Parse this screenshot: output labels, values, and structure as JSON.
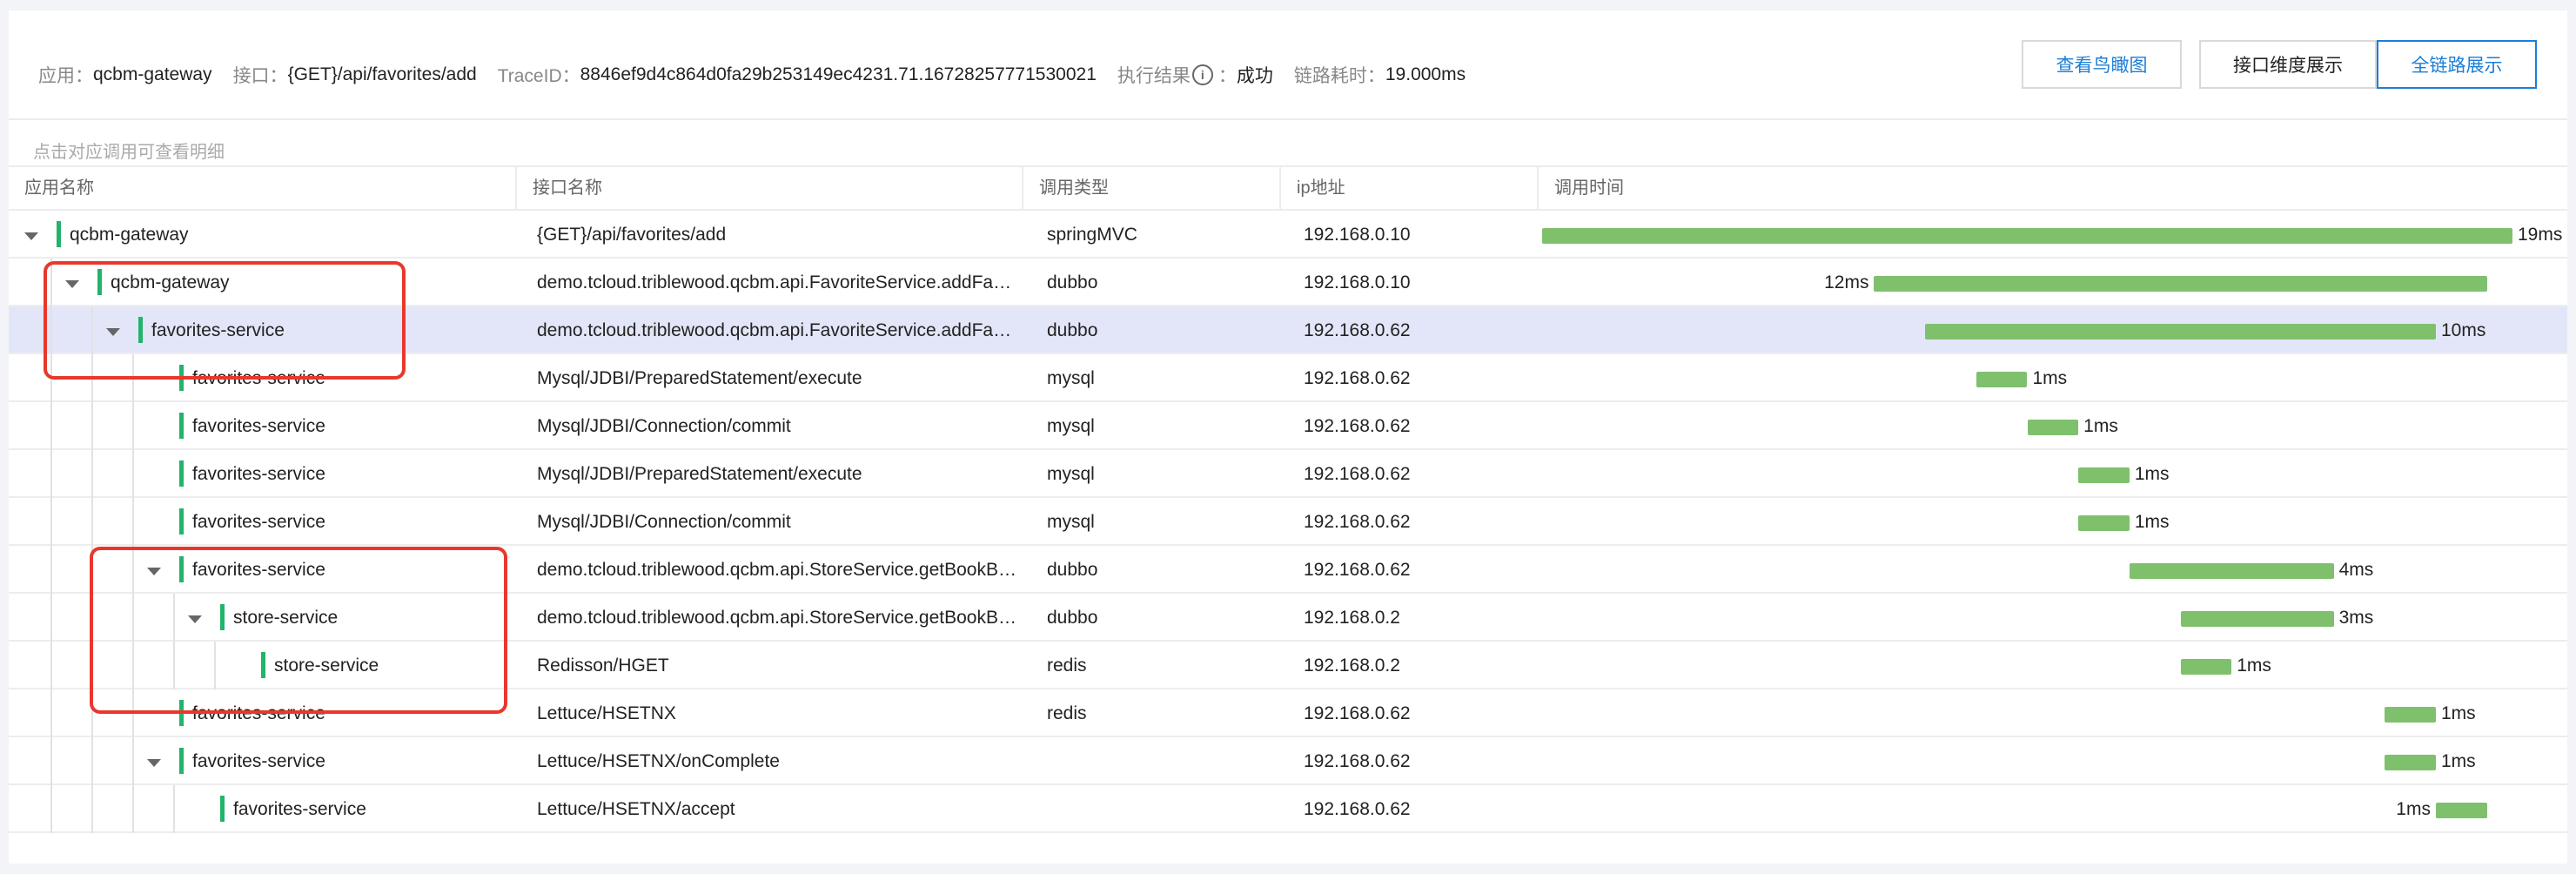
{
  "header": {
    "app_label": "应用：",
    "app_value": "qcbm-gateway",
    "iface_label": "接口：",
    "iface_value": "{GET}/api/favorites/add",
    "trace_label": "TraceID：",
    "trace_value": "8846ef9d4c864d0fa29b253149ec4231.71.16728257771530021",
    "result_label": "执行结果",
    "result_icon": "info-icon",
    "result_value": "成功",
    "duration_label": "链路耗时：",
    "duration_value": "19.000ms",
    "buttons": {
      "birdseye": "查看鸟瞰图",
      "interface_view": "接口维度展示",
      "full_chain": "全链路展示"
    },
    "active_button_color": "#1c7ed6"
  },
  "hint": "点击对应调用可查看明细",
  "columns": [
    "应用名称",
    "接口名称",
    "调用类型",
    "ip地址",
    "调用时间"
  ],
  "colors": {
    "bar": "#7fc06d",
    "app_marker": "#23b36b",
    "selected_row": "#e3e6f8",
    "highlight_box": "#e8382c"
  },
  "total_ms": 19,
  "rows": [
    {
      "depth": 0,
      "expand": true,
      "app": "qcbm-gateway",
      "iface": "{GET}/api/favorites/add",
      "type": "springMVC",
      "ip": "192.168.0.10",
      "start_ms": 0,
      "dur_ms": 19,
      "label": "19ms",
      "label_side": "right",
      "selected": false
    },
    {
      "depth": 1,
      "expand": true,
      "app": "qcbm-gateway",
      "iface": "demo.tcloud.triblewood.qcbm.api.FavoriteService.addFavorite",
      "type": "dubbo",
      "ip": "192.168.0.10",
      "start_ms": 6.5,
      "dur_ms": 12,
      "label": "12ms",
      "label_side": "left",
      "selected": false
    },
    {
      "depth": 2,
      "expand": true,
      "app": "favorites-service",
      "iface": "demo.tcloud.triblewood.qcbm.api.FavoriteService.addFavorite",
      "type": "dubbo",
      "ip": "192.168.0.62",
      "start_ms": 7.5,
      "dur_ms": 10,
      "label": "10ms",
      "label_side": "right",
      "selected": true
    },
    {
      "depth": 3,
      "expand": false,
      "app": "favorites-service",
      "iface": "Mysql/JDBI/PreparedStatement/execute",
      "type": "mysql",
      "ip": "192.168.0.62",
      "start_ms": 8.5,
      "dur_ms": 1,
      "label": "1ms",
      "label_side": "right",
      "selected": false
    },
    {
      "depth": 3,
      "expand": false,
      "app": "favorites-service",
      "iface": "Mysql/JDBI/Connection/commit",
      "type": "mysql",
      "ip": "192.168.0.62",
      "start_ms": 9.5,
      "dur_ms": 1,
      "label": "1ms",
      "label_side": "right",
      "selected": false
    },
    {
      "depth": 3,
      "expand": false,
      "app": "favorites-service",
      "iface": "Mysql/JDBI/PreparedStatement/execute",
      "type": "mysql",
      "ip": "192.168.0.62",
      "start_ms": 10.5,
      "dur_ms": 1,
      "label": "1ms",
      "label_side": "right",
      "selected": false
    },
    {
      "depth": 3,
      "expand": false,
      "app": "favorites-service",
      "iface": "Mysql/JDBI/Connection/commit",
      "type": "mysql",
      "ip": "192.168.0.62",
      "start_ms": 10.5,
      "dur_ms": 1,
      "label": "1ms",
      "label_side": "right",
      "selected": false
    },
    {
      "depth": 3,
      "expand": true,
      "app": "favorites-service",
      "iface": "demo.tcloud.triblewood.qcbm.api.StoreService.getBookById",
      "type": "dubbo",
      "ip": "192.168.0.62",
      "start_ms": 11.5,
      "dur_ms": 4,
      "label": "4ms",
      "label_side": "right",
      "selected": false
    },
    {
      "depth": 4,
      "expand": true,
      "app": "store-service",
      "iface": "demo.tcloud.triblewood.qcbm.api.StoreService.getBookById",
      "type": "dubbo",
      "ip": "192.168.0.2",
      "start_ms": 12.5,
      "dur_ms": 3,
      "label": "3ms",
      "label_side": "right",
      "selected": false
    },
    {
      "depth": 5,
      "expand": false,
      "app": "store-service",
      "iface": "Redisson/HGET",
      "type": "redis",
      "ip": "192.168.0.2",
      "start_ms": 12.5,
      "dur_ms": 1,
      "label": "1ms",
      "label_side": "right",
      "selected": false
    },
    {
      "depth": 3,
      "expand": false,
      "app": "favorites-service",
      "iface": "Lettuce/HSETNX",
      "type": "redis",
      "ip": "192.168.0.62",
      "start_ms": 16.5,
      "dur_ms": 1,
      "label": "1ms",
      "label_side": "right",
      "selected": false
    },
    {
      "depth": 3,
      "expand": true,
      "app": "favorites-service",
      "iface": "Lettuce/HSETNX/onComplete",
      "type": "",
      "ip": "192.168.0.62",
      "start_ms": 16.5,
      "dur_ms": 1,
      "label": "1ms",
      "label_side": "right",
      "selected": false
    },
    {
      "depth": 4,
      "expand": false,
      "app": "favorites-service",
      "iface": "Lettuce/HSETNX/accept",
      "type": "",
      "ip": "192.168.0.62",
      "start_ms": 17.5,
      "dur_ms": 1,
      "label": "1ms",
      "label_side": "left",
      "selected": false
    }
  ]
}
